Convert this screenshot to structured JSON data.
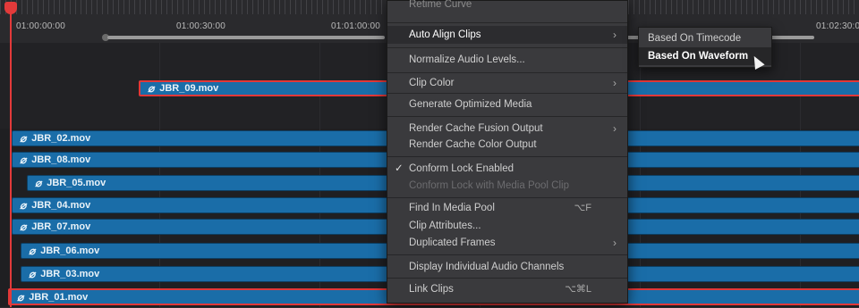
{
  "ruler": {
    "timecodes": [
      "01:00:00:00",
      "01:00:30:00",
      "01:01:00:00",
      "01:02:30:0"
    ]
  },
  "clips": [
    {
      "name": "JBR_09.mov",
      "selected": true
    },
    {
      "name": "JBR_02.mov",
      "selected": false
    },
    {
      "name": "JBR_08.mov",
      "selected": false
    },
    {
      "name": "JBR_05.mov",
      "selected": false
    },
    {
      "name": "JBR_04.mov",
      "selected": false
    },
    {
      "name": "JBR_07.mov",
      "selected": false
    },
    {
      "name": "JBR_06.mov",
      "selected": false
    },
    {
      "name": "JBR_03.mov",
      "selected": false
    },
    {
      "name": "JBR_01.mov",
      "selected": true
    }
  ],
  "link_glyph": "⌀",
  "context_menu": {
    "items": [
      {
        "label": "Retime Curve",
        "state": "cut"
      },
      {
        "label": "Auto Align Clips",
        "state": "active",
        "submenu": true
      },
      {
        "label": "Normalize Audio Levels...",
        "state": "normal"
      },
      {
        "label": "Clip Color",
        "state": "normal",
        "submenu": true
      },
      {
        "label": "Generate Optimized Media",
        "state": "normal"
      },
      {
        "label": "Render Cache Fusion Output",
        "state": "normal",
        "submenu": true
      },
      {
        "label": "Render Cache Color Output",
        "state": "normal"
      },
      {
        "label": "Conform Lock Enabled",
        "state": "checked"
      },
      {
        "label": "Conform Lock with Media Pool Clip",
        "state": "disabled"
      },
      {
        "label": "Find In Media Pool",
        "state": "normal",
        "shortcut": "⌥F"
      },
      {
        "label": "Clip Attributes...",
        "state": "normal"
      },
      {
        "label": "Duplicated Frames",
        "state": "normal",
        "submenu": true
      },
      {
        "label": "Display Individual Audio Channels",
        "state": "normal"
      },
      {
        "label": "Link Clips",
        "state": "normal",
        "shortcut": "⌥⌘L"
      }
    ],
    "check_glyph": "✓",
    "arrow_glyph": "›"
  },
  "submenu": {
    "items": [
      {
        "label": "Based On Timecode",
        "state": "normal"
      },
      {
        "label": "Based On Waveform",
        "state": "active"
      }
    ]
  },
  "colors": {
    "clip_blue": "#1a6da8",
    "selection_red": "#e23838",
    "playhead_red": "#e33a3a",
    "menu_bg": "#3a3a3d"
  }
}
